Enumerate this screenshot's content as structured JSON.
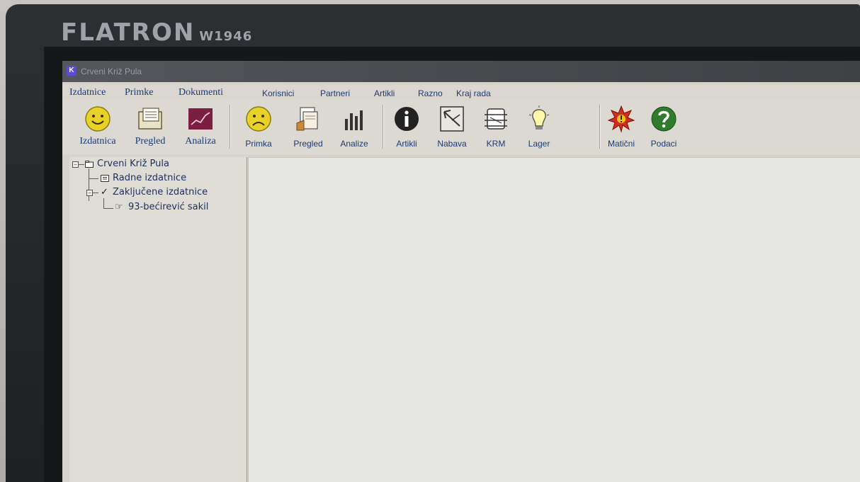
{
  "monitor": {
    "brand": "FLATRON",
    "model": "W1946"
  },
  "window": {
    "title": "Crveni Križ Pula"
  },
  "menu": [
    "Izdatnice",
    "Primke",
    "Dokumenti",
    "Korisnici",
    "Partneri",
    "Artikli",
    "Razno",
    "Kraj rada"
  ],
  "toolbar": {
    "group1": [
      {
        "label": "Izdatnica",
        "icon": "smiley-happy-icon"
      },
      {
        "label": "Pregled",
        "icon": "document-list-icon"
      },
      {
        "label": "Analiza",
        "icon": "chart-trend-icon"
      }
    ],
    "group2": [
      {
        "label": "Primka",
        "icon": "smiley-sad-icon"
      },
      {
        "label": "Pregled",
        "icon": "document-stack-icon"
      },
      {
        "label": "Analize",
        "icon": "bar-chart-icon"
      }
    ],
    "group3": [
      {
        "label": "Artikli",
        "icon": "info-icon"
      },
      {
        "label": "Nabava",
        "icon": "nabava-icon"
      },
      {
        "label": "KRM",
        "icon": "krm-icon"
      },
      {
        "label": "Lager",
        "icon": "lightbulb-icon"
      }
    ],
    "group4": [
      {
        "label": "Matični",
        "icon": "alert-burst-icon"
      },
      {
        "label": "Podaci",
        "icon": "help-icon"
      }
    ]
  },
  "tree": {
    "root": "Crveni Križ Pula",
    "children": [
      {
        "label": "Radne izdatnice"
      },
      {
        "label": "Zaključene izdatnice",
        "children": [
          {
            "label": "93-bećirević sakil"
          }
        ]
      }
    ]
  },
  "colors": {
    "menu_text": "#1c3a74",
    "window_bg": "#d6d3cc",
    "main_bg": "#e6e7e3"
  }
}
